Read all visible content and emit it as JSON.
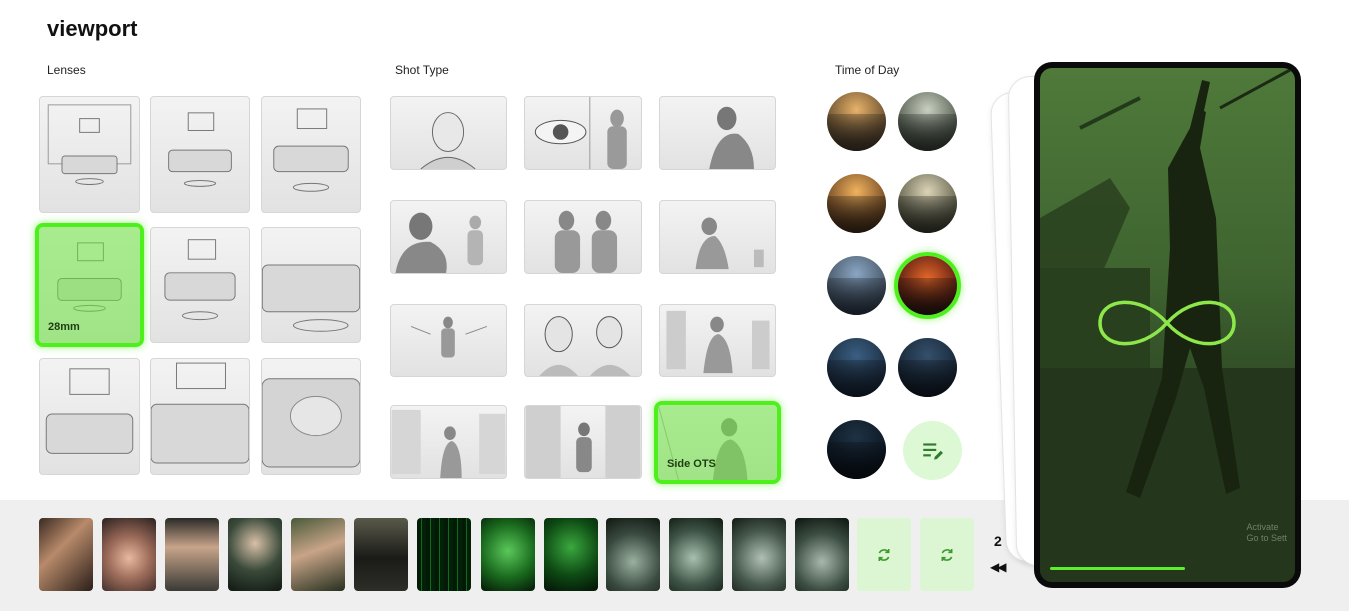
{
  "app": {
    "title": "viewport"
  },
  "sections": {
    "lenses_label": "Lenses",
    "shot_type_label": "Shot Type",
    "time_of_day_label": "Time of Day"
  },
  "lenses": [
    {
      "label": "",
      "selected": false
    },
    {
      "label": "",
      "selected": false
    },
    {
      "label": "",
      "selected": false
    },
    {
      "label": "28mm",
      "selected": true
    },
    {
      "label": "",
      "selected": false
    },
    {
      "label": "",
      "selected": false
    },
    {
      "label": "",
      "selected": false
    },
    {
      "label": "",
      "selected": false
    },
    {
      "label": "",
      "selected": false
    }
  ],
  "shot_types": [
    {
      "label": "",
      "selected": false
    },
    {
      "label": "",
      "selected": false
    },
    {
      "label": "",
      "selected": false
    },
    {
      "label": "",
      "selected": false
    },
    {
      "label": "",
      "selected": false
    },
    {
      "label": "",
      "selected": false
    },
    {
      "label": "",
      "selected": false
    },
    {
      "label": "",
      "selected": false
    },
    {
      "label": "",
      "selected": false
    },
    {
      "label": "",
      "selected": false
    },
    {
      "label": "",
      "selected": false
    },
    {
      "label": "Side OTS",
      "selected": true
    }
  ],
  "time_of_day": {
    "selected_index": 5,
    "edit_icon": "edit-list-icon"
  },
  "timeline": {
    "clip_count": 13,
    "regenerate_icon": "refresh-icon",
    "shot_number": "2",
    "rewind_icon": "rewind-icon",
    "rewind_glyph": "◀◀"
  },
  "preview": {
    "overlay_icon": "infinity-icon",
    "watermark_line1": "Activate",
    "watermark_line2": "Go to Sett",
    "progress": 0.55
  },
  "colors": {
    "accent": "#4ef01c",
    "accent_soft": "#ddf8d4"
  }
}
